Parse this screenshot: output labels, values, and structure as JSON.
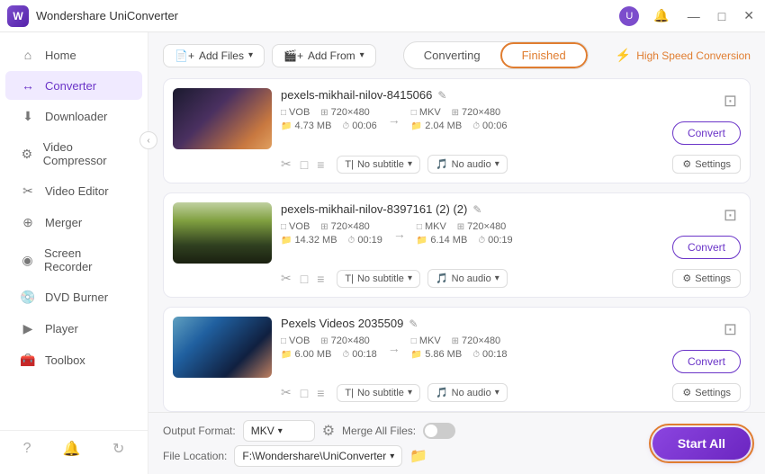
{
  "titleBar": {
    "appName": "Wondershare UniConverter",
    "controls": {
      "profile": "U",
      "bell": "🔔",
      "minimize": "—",
      "maximize": "□",
      "close": "✕"
    }
  },
  "sidebar": {
    "items": [
      {
        "id": "home",
        "label": "Home",
        "icon": "⌂",
        "active": false
      },
      {
        "id": "converter",
        "label": "Converter",
        "icon": "↔",
        "active": true
      },
      {
        "id": "downloader",
        "label": "Downloader",
        "icon": "⬇",
        "active": false
      },
      {
        "id": "video-compressor",
        "label": "Video Compressor",
        "icon": "⚙",
        "active": false
      },
      {
        "id": "video-editor",
        "label": "Video Editor",
        "icon": "✂",
        "active": false
      },
      {
        "id": "merger",
        "label": "Merger",
        "icon": "⊕",
        "active": false
      },
      {
        "id": "screen-recorder",
        "label": "Screen Recorder",
        "icon": "◉",
        "active": false
      },
      {
        "id": "dvd-burner",
        "label": "DVD Burner",
        "icon": "💿",
        "active": false
      },
      {
        "id": "player",
        "label": "Player",
        "icon": "▶",
        "active": false
      },
      {
        "id": "toolbox",
        "label": "Toolbox",
        "icon": "🧰",
        "active": false
      }
    ],
    "footer": {
      "help": "?",
      "notifications": "🔔",
      "refresh": "↻"
    }
  },
  "toolbar": {
    "addFilesLabel": "Add Files",
    "addFromLabel": "Add From",
    "tabs": {
      "converting": "Converting",
      "finished": "Finished"
    },
    "activeTab": "Finished",
    "highSpeedLabel": "High Speed Conversion"
  },
  "videos": [
    {
      "id": 1,
      "title": "pexels-mikhail-nilov-8415066",
      "thumbClass": "thumb-1",
      "source": {
        "format": "VOB",
        "resolution": "720×480",
        "size": "4.73 MB",
        "duration": "00:06"
      },
      "target": {
        "format": "MKV",
        "resolution": "720×480",
        "size": "2.04 MB",
        "duration": "00:06"
      },
      "subtitle": "No subtitle",
      "audio": "No audio",
      "convertBtnLabel": "Convert"
    },
    {
      "id": 2,
      "title": "pexels-mikhail-nilov-8397161 (2) (2)",
      "thumbClass": "thumb-2",
      "source": {
        "format": "VOB",
        "resolution": "720×480",
        "size": "14.32 MB",
        "duration": "00:19"
      },
      "target": {
        "format": "MKV",
        "resolution": "720×480",
        "size": "6.14 MB",
        "duration": "00:19"
      },
      "subtitle": "No subtitle",
      "audio": "No audio",
      "convertBtnLabel": "Convert"
    },
    {
      "id": 3,
      "title": "Pexels Videos 2035509",
      "thumbClass": "thumb-3",
      "source": {
        "format": "VOB",
        "resolution": "720×480",
        "size": "6.00 MB",
        "duration": "00:18"
      },
      "target": {
        "format": "MKV",
        "resolution": "720×480",
        "size": "5.86 MB",
        "duration": "00:18"
      },
      "subtitle": "No subtitle",
      "audio": "No audio",
      "convertBtnLabel": "Convert"
    }
  ],
  "bottomBar": {
    "outputFormatLabel": "Output Format:",
    "outputFormat": "MKV",
    "mergeFilesLabel": "Merge All Files:",
    "fileLocationLabel": "File Location:",
    "filePath": "F:\\Wondershare\\UniConverter",
    "startAllLabel": "Start All"
  }
}
